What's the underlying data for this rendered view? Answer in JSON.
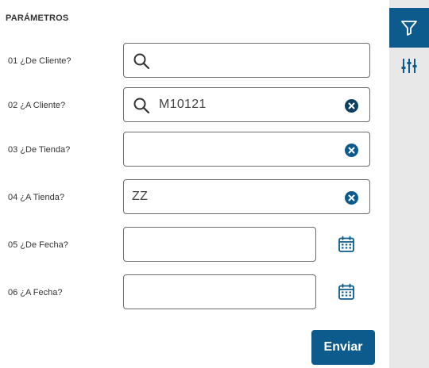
{
  "section_title": "PARÁMETROS",
  "fields": [
    {
      "label": "01 ¿De Cliente?",
      "value": ""
    },
    {
      "label": "02 ¿A Cliente?",
      "value": "M10121"
    },
    {
      "label": "03 ¿De Tienda?",
      "value": ""
    },
    {
      "label": "04 ¿A Tienda?",
      "value": "ZZ"
    },
    {
      "label": "05 ¿De Fecha?",
      "value": ""
    },
    {
      "label": "06 ¿A Fecha?",
      "value": ""
    }
  ],
  "submit_label": "Enviar",
  "colors": {
    "accent": "#0d5b8c",
    "sidebar_bg": "#e8e8e8",
    "border": "#6b6b6b"
  },
  "icons": {
    "search": "search-icon",
    "clear": "clear-icon",
    "calendar": "calendar-icon",
    "filter": "filter-icon",
    "settings": "sliders-icon"
  }
}
